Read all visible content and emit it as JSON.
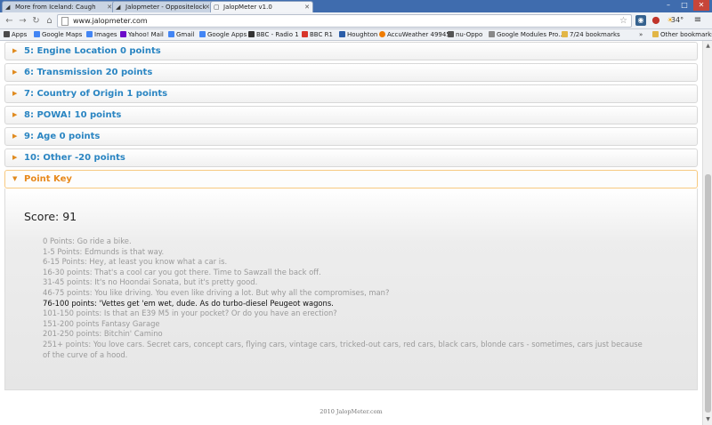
{
  "browser": {
    "tabs": [
      {
        "title": "More from Iceland: Caugh",
        "active": false
      },
      {
        "title": "Jalopmeter - Oppositelock",
        "active": false
      },
      {
        "title": "JalopMeter v1.0",
        "active": true
      }
    ],
    "address": "www.jalopmeter.com",
    "temperature": "34°",
    "bookmarks": [
      {
        "label": "Apps",
        "icon_color": "#4a4a4a"
      },
      {
        "label": "Google Maps",
        "icon_color": "#4285f4"
      },
      {
        "label": "Images",
        "icon_color": "#4285f4"
      },
      {
        "label": "Yahoo! Mail",
        "icon_color": "#6b0ac9"
      },
      {
        "label": "Gmail",
        "icon_color": "#4285f4"
      },
      {
        "label": "Google Apps",
        "icon_color": "#4285f4"
      },
      {
        "label": "BBC - Radio 1",
        "icon_color": "#333333"
      },
      {
        "label": "BBC R1",
        "icon_color": "#d8352a"
      },
      {
        "label": "Houghton",
        "icon_color": "#2a5da8"
      },
      {
        "label": "AccuWeather 49945",
        "icon_color": "#f07c00"
      },
      {
        "label": "nu-Oppo",
        "icon_color": "#555555"
      },
      {
        "label": "Google Modules Pro...",
        "icon_color": "#888888"
      },
      {
        "label": "7/24 bookmarks",
        "icon_color": "#e2b646"
      }
    ],
    "other_bookmarks": "Other bookmarks"
  },
  "accordion": [
    {
      "label": "5: Engine Location 0 points",
      "open": false
    },
    {
      "label": "6: Transmission 20 points",
      "open": false
    },
    {
      "label": "7: Country of Origin 1 points",
      "open": false
    },
    {
      "label": "8: POWA! 10 points",
      "open": false
    },
    {
      "label": "9: Age 0 points",
      "open": false
    },
    {
      "label": "10: Other -20 points",
      "open": false
    },
    {
      "label": "Point Key",
      "open": true
    }
  ],
  "point_key": {
    "score": "Score: 91",
    "lines": [
      "0 Points: Go ride a bike.",
      "1-5 Points: Edmunds is that way.",
      "6-15 Points: Hey, at least you know what a car is.",
      "16-30 points: That's a cool car you got there. Time to Sawzall the back off.",
      "31-45 points: It's no Hoondai Sonata, but it's pretty good.",
      "46-75 points: You like driving. You even like driving a lot. But why all the compromises, man?",
      "76-100 points: 'Vettes get 'em wet, dude. As do turbo-diesel Peugeot wagons.",
      "101-150 points: Is that an E39 M5 in your pocket? Or do you have an erection?",
      "151-200 points Fantasy Garage",
      "201-250 points: Bitchin' Camino",
      "251+ points: You love cars. Secret cars, concept cars, flying cars, vintage cars, tricked-out cars, red cars, black cars, blonde cars - sometimes, cars just because",
      "of the curve of a hood."
    ],
    "highlight_index": 6
  },
  "footer": "2010 JalopMeter.com",
  "colors": {
    "link_blue": "#2a85c2",
    "active_orange": "#e7891c",
    "muted_text": "#9a9a9a"
  }
}
